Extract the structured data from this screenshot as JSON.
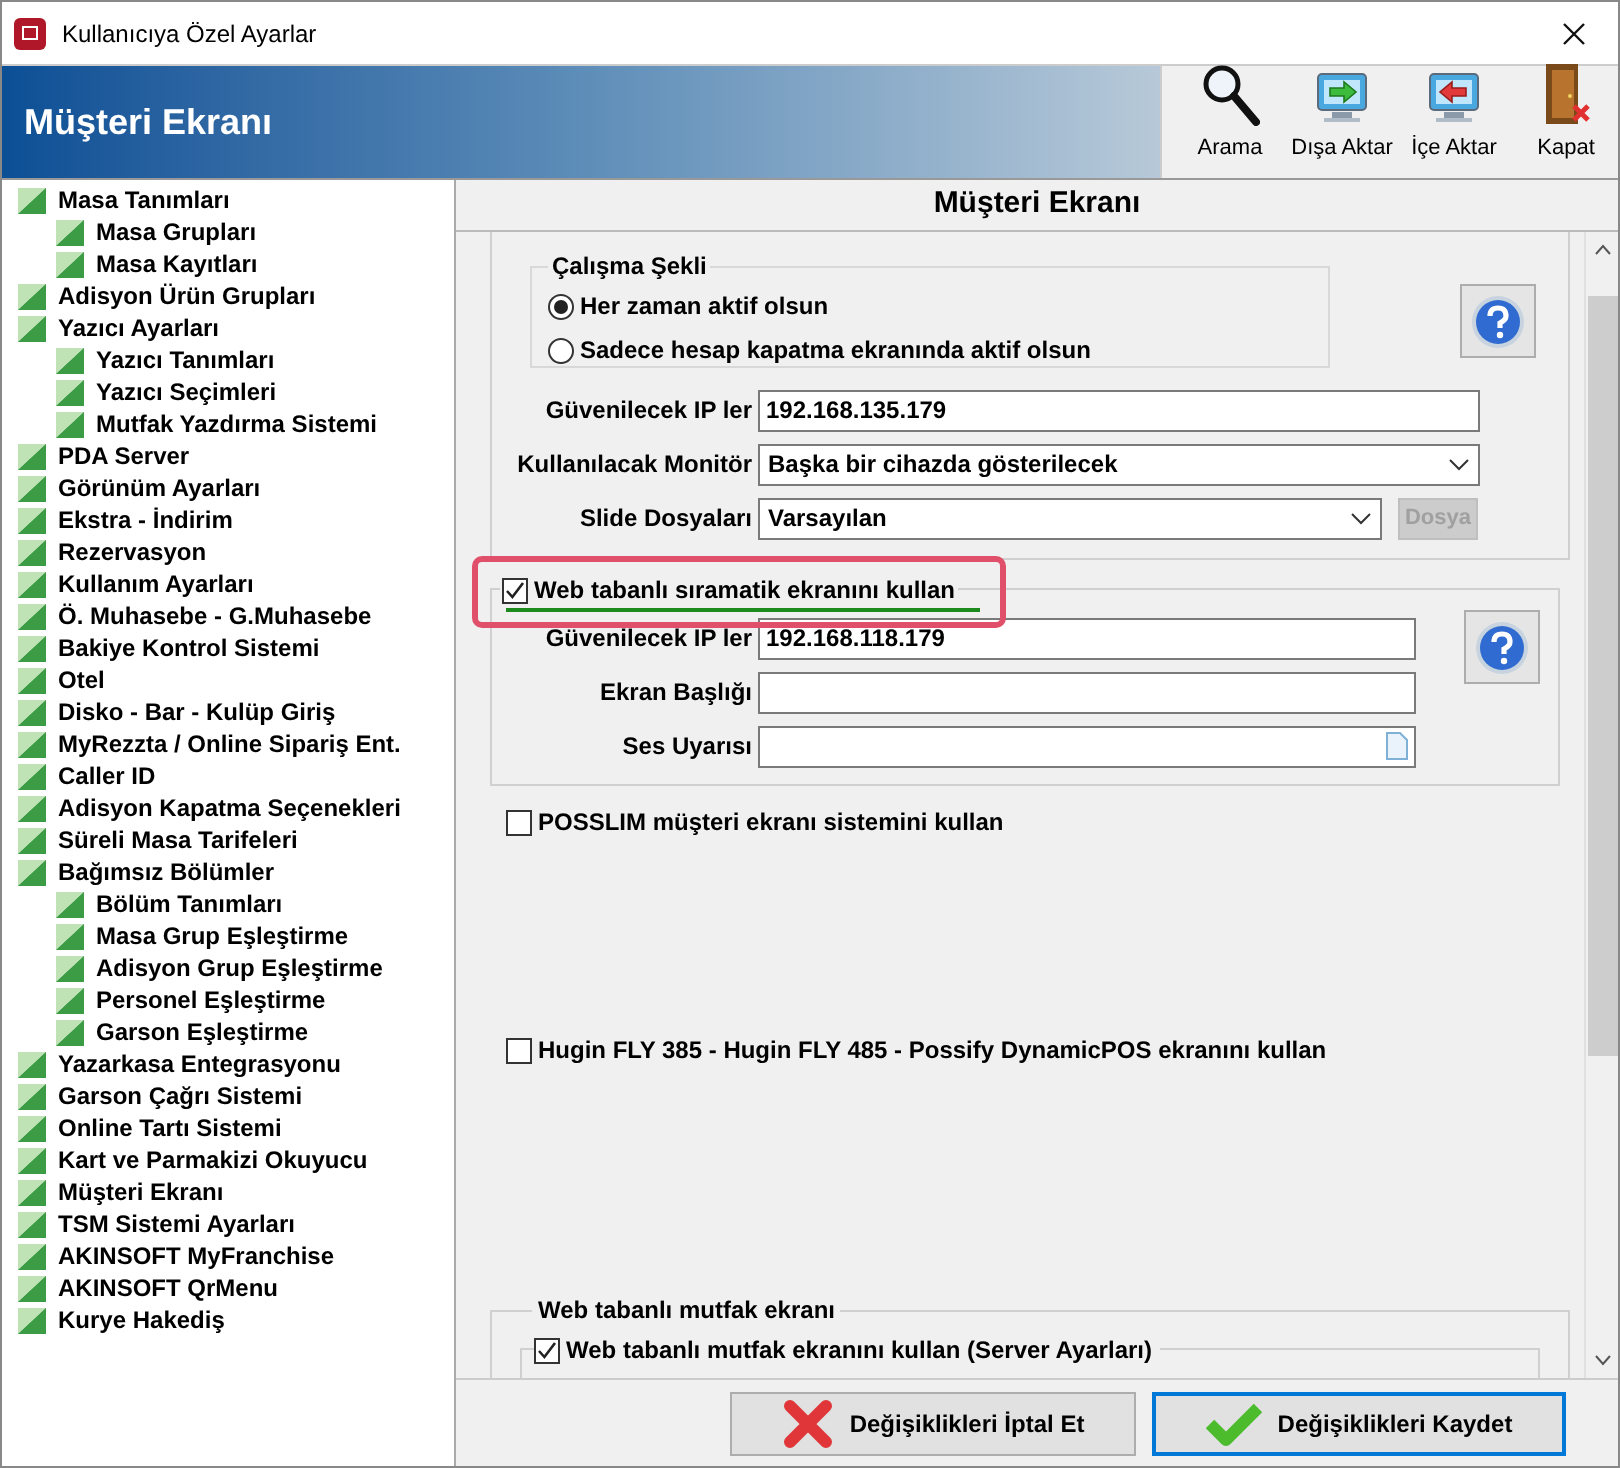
{
  "window": {
    "title": "Kullanıcıya Özel Ayarlar"
  },
  "header": {
    "title": "Müşteri Ekranı"
  },
  "toolbar": [
    {
      "label": "Arama",
      "kind": "search"
    },
    {
      "label": "Dışa Aktar",
      "kind": "export"
    },
    {
      "label": "İçe Aktar",
      "kind": "import"
    },
    {
      "label": "Kapat",
      "kind": "close"
    }
  ],
  "tree": [
    {
      "label": "Masa Tanımları",
      "children": [
        {
          "label": "Masa Grupları"
        },
        {
          "label": "Masa Kayıtları"
        }
      ]
    },
    {
      "label": "Adisyon Ürün Grupları"
    },
    {
      "label": "Yazıcı Ayarları",
      "children": [
        {
          "label": "Yazıcı Tanımları"
        },
        {
          "label": "Yazıcı Seçimleri"
        },
        {
          "label": "Mutfak Yazdırma Sistemi"
        }
      ]
    },
    {
      "label": "PDA Server"
    },
    {
      "label": "Görünüm Ayarları"
    },
    {
      "label": "Ekstra - İndirim"
    },
    {
      "label": "Rezervasyon"
    },
    {
      "label": "Kullanım Ayarları"
    },
    {
      "label": "Ö. Muhasebe - G.Muhasebe"
    },
    {
      "label": "Bakiye Kontrol Sistemi"
    },
    {
      "label": "Otel"
    },
    {
      "label": "Disko - Bar - Kulüp Giriş"
    },
    {
      "label": "MyRezzta / Online Sipariş Ent."
    },
    {
      "label": "Caller ID"
    },
    {
      "label": "Adisyon Kapatma Seçenekleri"
    },
    {
      "label": "Süreli Masa Tarifeleri"
    },
    {
      "label": "Bağımsız Bölümler",
      "children": [
        {
          "label": "Bölüm Tanımları"
        },
        {
          "label": "Masa Grup Eşleştirme"
        },
        {
          "label": "Adisyon Grup Eşleştirme"
        },
        {
          "label": "Personel Eşleştirme"
        },
        {
          "label": "Garson Eşleştirme"
        }
      ]
    },
    {
      "label": "Yazarkasa Entegrasyonu"
    },
    {
      "label": "Garson Çağrı Sistemi"
    },
    {
      "label": "Online Tartı Sistemi"
    },
    {
      "label": "Kart ve Parmakizi Okuyucu"
    },
    {
      "label": "Müşteri Ekranı"
    },
    {
      "label": "TSM Sistemi Ayarları"
    },
    {
      "label": "AKINSOFT MyFranchise"
    },
    {
      "label": "AKINSOFT QrMenu"
    },
    {
      "label": "Kurye Hakediş"
    }
  ],
  "panel": {
    "title": "Müşteri Ekranı",
    "customer_display": {
      "work_mode": {
        "title": "Çalışma Şekli",
        "options": [
          {
            "label": "Her zaman aktif olsun",
            "selected": true
          },
          {
            "label": "Sadece hesap kapatma ekranında aktif olsun",
            "selected": false
          }
        ]
      },
      "fields": [
        {
          "kind": "text",
          "label": "Güvenilecek IP ler",
          "value": "192.168.135.179"
        },
        {
          "kind": "select",
          "label": "Kullanılacak Monitör",
          "value": "Başka bir cihazda gösterilecek"
        },
        {
          "kind": "select",
          "label": "Slide Dosyaları",
          "value": "Varsayılan",
          "button": {
            "label": "Dosya",
            "disabled": true
          }
        }
      ]
    },
    "web_queue": {
      "label": "Web tabanlı sıramatik ekranını kullan",
      "checked": true,
      "highlighted": true,
      "fields": [
        {
          "kind": "text",
          "label": "Güvenilecek IP ler",
          "value": "192.168.118.179"
        },
        {
          "kind": "text",
          "label": "Ekran Başlığı"
        },
        {
          "kind": "file",
          "label": "Ses Uyarısı"
        }
      ]
    },
    "options": [
      {
        "label": "POSSLIM müşteri ekranı sistemini kullan",
        "checked": false
      },
      {
        "label": "Hugin FLY 385 - Hugin FLY 485 - Possify DynamicPOS ekranını kullan",
        "checked": false
      }
    ],
    "web_kitchen": {
      "title": "Web tabanlı mutfak ekranı",
      "option": {
        "label": "Web tabanlı mutfak ekranını kullan (Server Ayarları)",
        "checked": true
      }
    }
  },
  "buttons": [
    {
      "kind": "cancel",
      "label": "Değişiklikleri İptal Et",
      "focused": false
    },
    {
      "kind": "save",
      "label": "Değişiklikleri Kaydet",
      "focused": true
    }
  ]
}
